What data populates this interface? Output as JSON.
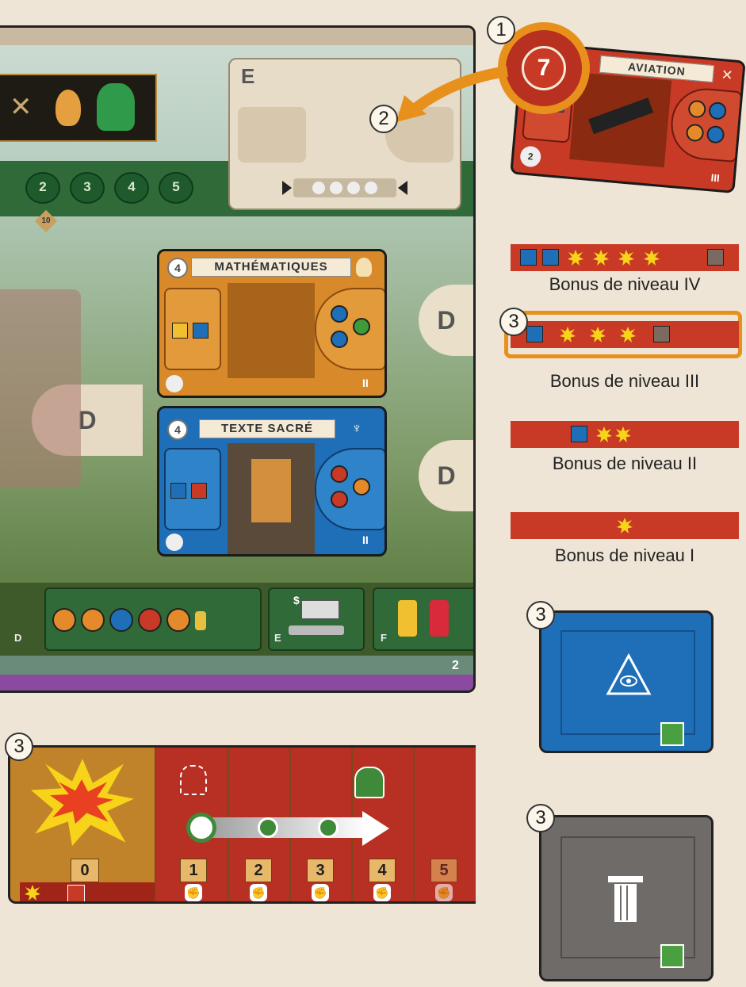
{
  "callouts": {
    "c1": "1",
    "c2": "2",
    "c3": "3"
  },
  "board": {
    "panel_letter_e": "E",
    "slot_letter_d": "D",
    "laurels": [
      "2",
      "3",
      "4",
      "5"
    ],
    "small_badge": "10",
    "footer_letters": [
      "D",
      "E",
      "F"
    ],
    "page_number": "2",
    "dollar": "$"
  },
  "cards": {
    "aviation": {
      "cost": "7",
      "title": "AVIATION",
      "laurel": "2",
      "era": "III"
    },
    "mathematiques": {
      "cost": "4",
      "title": "MATHÉMATIQUES",
      "laurel": "",
      "era": "II"
    },
    "texte_sacre": {
      "cost": "4",
      "title": "TEXTE SACRÉ",
      "era": "II"
    }
  },
  "bonus_levels": [
    {
      "label": "Bonus de niveau IV",
      "stars": 4,
      "shields": 2,
      "column": 1
    },
    {
      "label": "Bonus de niveau III",
      "stars": 3,
      "shields": 1,
      "column": 1
    },
    {
      "label": "Bonus de niveau II",
      "stars": 2,
      "shields": 1,
      "column": 0
    },
    {
      "label": "Bonus de niveau I",
      "stars": 1,
      "shields": 0,
      "column": 0
    }
  ],
  "track": {
    "numbers": [
      "0",
      "1",
      "2",
      "3",
      "4",
      "5"
    ]
  },
  "colors": {
    "red": "#c83a25",
    "blue": "#1e6fb8",
    "gray": "#6f6b68",
    "orange": "#e8901c",
    "green": "#3f8a3a"
  }
}
